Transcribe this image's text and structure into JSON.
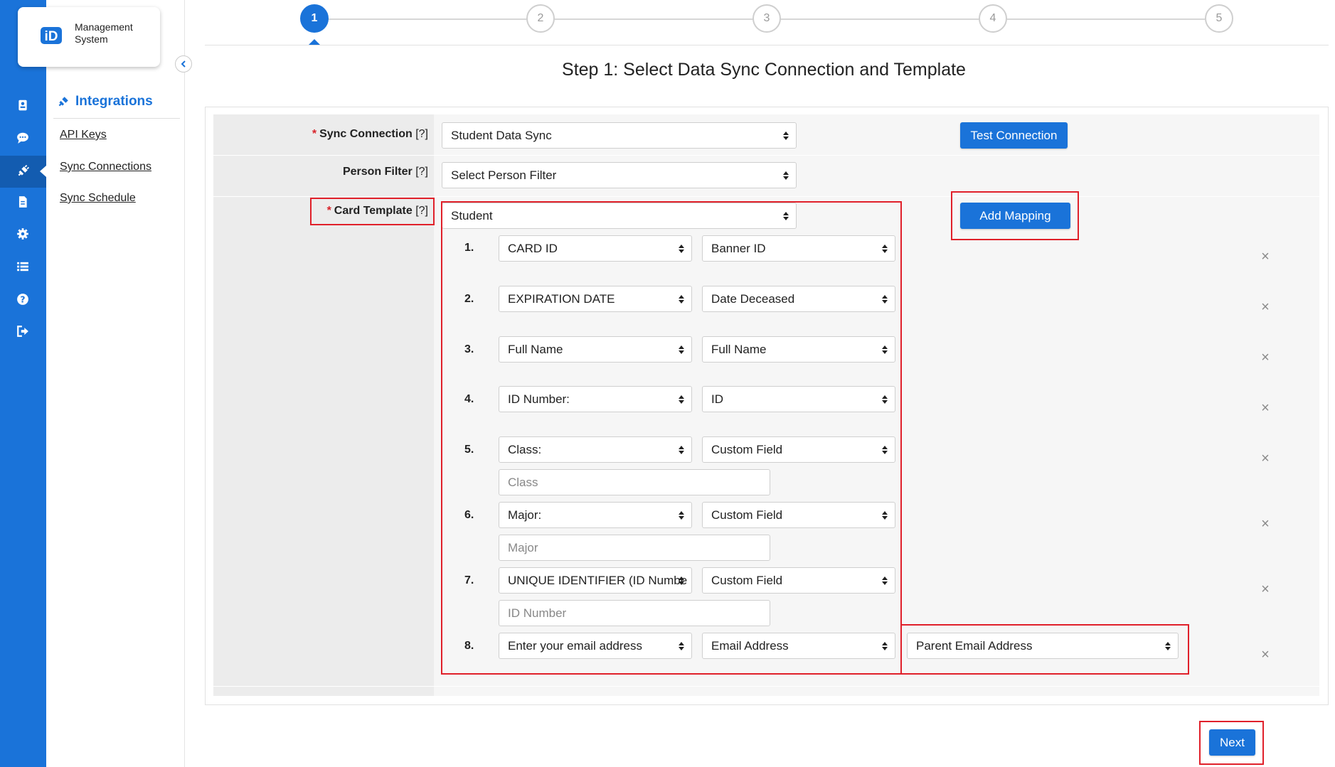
{
  "app": {
    "logo_text": "Management System",
    "logo_mark": "iD"
  },
  "rail": {
    "icons": [
      "id-card-icon",
      "chat-icon",
      "plug-icon",
      "document-icon",
      "gear-icon",
      "list-icon",
      "help-icon",
      "sign-out-icon"
    ],
    "active": "plug-icon"
  },
  "subnav": {
    "title": "Integrations",
    "title_icon": "plug-icon",
    "links": [
      "API Keys",
      "Sync Connections",
      "Sync Schedule"
    ]
  },
  "stepper": {
    "steps": [
      "1",
      "2",
      "3",
      "4",
      "5"
    ],
    "active_step": "1"
  },
  "page": {
    "title": "Step 1: Select Data Sync Connection and Template"
  },
  "form": {
    "sync_connection": {
      "label": "Sync Connection",
      "help": "[?]",
      "required_mark": "*",
      "value": "Student Data Sync"
    },
    "test_connection_label": "Test Connection",
    "person_filter": {
      "label": "Person Filter",
      "help": "[?]",
      "value": "Select Person Filter"
    },
    "card_template": {
      "label": "Card Template",
      "help": "[?]",
      "required_mark": "*",
      "value": "Student"
    },
    "add_mapping_label": "Add Mapping",
    "mappings": [
      {
        "num": "1.",
        "field": "CARD ID",
        "source": "Banner ID"
      },
      {
        "num": "2.",
        "field": "EXPIRATION DATE",
        "source": "Date Deceased"
      },
      {
        "num": "3.",
        "field": "Full Name",
        "source": "Full Name"
      },
      {
        "num": "4.",
        "field": "ID Number:",
        "source": "ID"
      },
      {
        "num": "5.",
        "field": "Class:",
        "source": "Custom Field",
        "custom_placeholder": "Class"
      },
      {
        "num": "6.",
        "field": "Major:",
        "source": "Custom Field",
        "custom_placeholder": "Major"
      },
      {
        "num": "7.",
        "field": "UNIQUE IDENTIFIER (ID Numbe",
        "source": "Custom Field",
        "custom_placeholder": "ID Number"
      },
      {
        "num": "8.",
        "field": "Enter your email address",
        "source": "Email Address",
        "extra": "Parent Email Address"
      }
    ],
    "remove_glyph": "×"
  },
  "footer": {
    "next_label": "Next"
  },
  "colors": {
    "primary": "#1a73d9",
    "highlight": "#e0202a",
    "required": "#d8232a"
  }
}
